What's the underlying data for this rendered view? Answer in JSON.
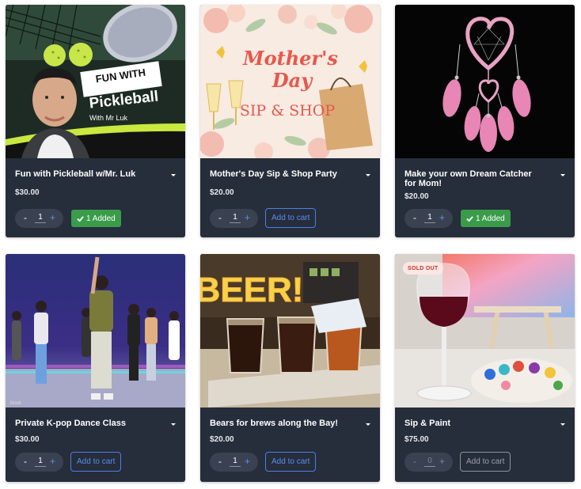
{
  "products": [
    {
      "title": "Fun with Pickleball w/Mr. Luk",
      "price": "$30.00",
      "qty": "1",
      "button": "1 Added",
      "image_text_1": "FUN WITH",
      "image_text_2": "Pickleball",
      "image_text_3": "With Mr Luk"
    },
    {
      "title": "Mother's Day Sip & Shop Party",
      "price": "$20.00",
      "qty": "1",
      "button": "Add to cart",
      "image_text_1": "Mother's",
      "image_text_2": "Day",
      "image_text_3": "SIP & SHOP"
    },
    {
      "title": "Make your own Dream Catcher for Mom!",
      "price": "$20.00",
      "qty": "1",
      "button": "1 Added"
    },
    {
      "title": "Private K-pop Dance Class",
      "price": "$30.00",
      "qty": "1",
      "button": "Add to cart"
    },
    {
      "title": "Bears for brews along the Bay!",
      "price": "$20.00",
      "qty": "1",
      "button": "Add to cart",
      "image_text_1": "BEER!"
    },
    {
      "title": "Sip & Paint",
      "price": "$75.00",
      "qty": "0",
      "button": "Add to cart",
      "badge": "SOLD OUT"
    }
  ],
  "stepper": {
    "minus": "-",
    "plus": "+"
  },
  "icons": {
    "chevron": "chevron-down-icon",
    "check": "check-icon"
  },
  "colors": {
    "card_bg": "#262d3b",
    "added_green": "#3a9c4a",
    "cart_blue": "#5a8ef0",
    "sold_out_red": "#c2362b"
  }
}
